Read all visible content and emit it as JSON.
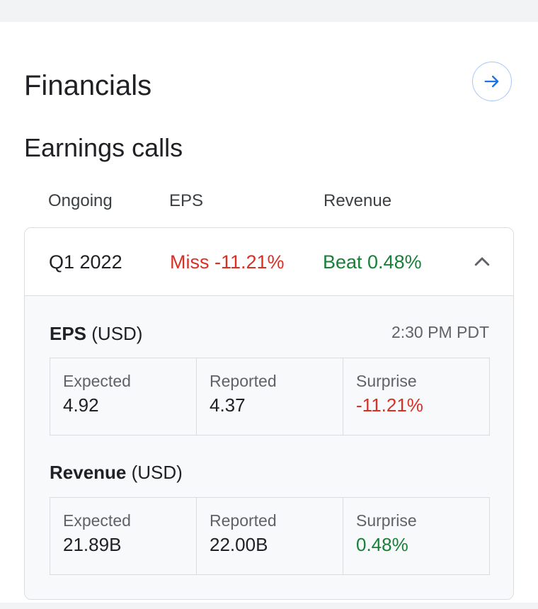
{
  "card": {
    "title": "Financials",
    "section_title": "Earnings calls"
  },
  "columns": {
    "period": "Ongoing",
    "eps": "EPS",
    "revenue": "Revenue"
  },
  "quarter": {
    "label": "Q1 2022",
    "eps_result": "Miss -11.21%",
    "revenue_result": "Beat 0.48%"
  },
  "eps": {
    "title_bold": "EPS",
    "unit": " (USD)",
    "time": "2:30 PM PDT",
    "expected_label": "Expected",
    "expected_value": "4.92",
    "reported_label": "Reported",
    "reported_value": "4.37",
    "surprise_label": "Surprise",
    "surprise_value": "-11.21%"
  },
  "revenue": {
    "title_bold": "Revenue",
    "unit": " (USD)",
    "expected_label": "Expected",
    "expected_value": "21.89B",
    "reported_label": "Reported",
    "reported_value": "22.00B",
    "surprise_label": "Surprise",
    "surprise_value": "0.48%"
  },
  "colors": {
    "negative": "#d93025",
    "positive": "#188038",
    "accent": "#1a73e8"
  },
  "icons": {
    "open": "arrow-right-icon",
    "collapse": "chevron-up-icon"
  }
}
